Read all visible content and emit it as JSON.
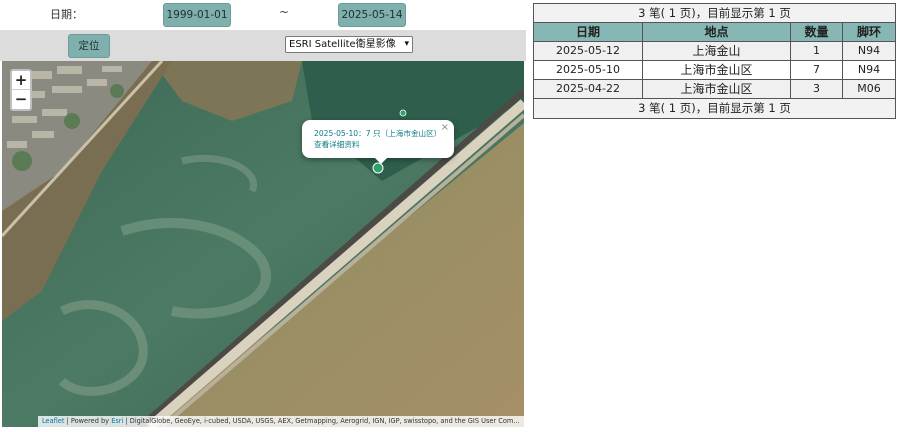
{
  "filters": {
    "date_label": "日期：",
    "date_from": "1999-01-01",
    "tilde": "~",
    "date_to": "2025-05-14"
  },
  "controls": {
    "locate_label": "定位",
    "layer_selected": "ESRI Satellite衛星影像"
  },
  "map": {
    "zoom_in": "+",
    "zoom_out": "−",
    "popup_line1": "2025-05-10：7 只（上海市金山区）",
    "popup_line2": "查看详细资料",
    "popup_close": "×",
    "attribution_leaflet": "Leaflet",
    "attribution_mid": " | Powered by ",
    "attribution_esri": "Esri",
    "attribution_rest": " | DigitalGlobe, GeoEye, i-cubed, USDA, USGS, AEX, Getmapping, Aerogrid, IGN, IGP, swisstopo, and the GIS User Com..."
  },
  "table": {
    "summary_top": "3 笔( 1 页)，目前显示第 1 页",
    "headers": [
      "日期",
      "地点",
      "数量",
      "脚环"
    ],
    "rows": [
      [
        "2025-05-12",
        "上海金山",
        "1",
        "N94"
      ],
      [
        "2025-05-10",
        "上海市金山区",
        "7",
        "N94"
      ],
      [
        "2025-04-22",
        "上海市金山区",
        "3",
        "M06"
      ]
    ],
    "summary_bottom": "3 笔( 1 页)，目前显示第 1 页"
  },
  "colors": {
    "button_teal": "#7fb0ad",
    "header_teal": "#86b7b4",
    "popup_text": "#0a7a86",
    "marker_green": "#2ea36a"
  }
}
